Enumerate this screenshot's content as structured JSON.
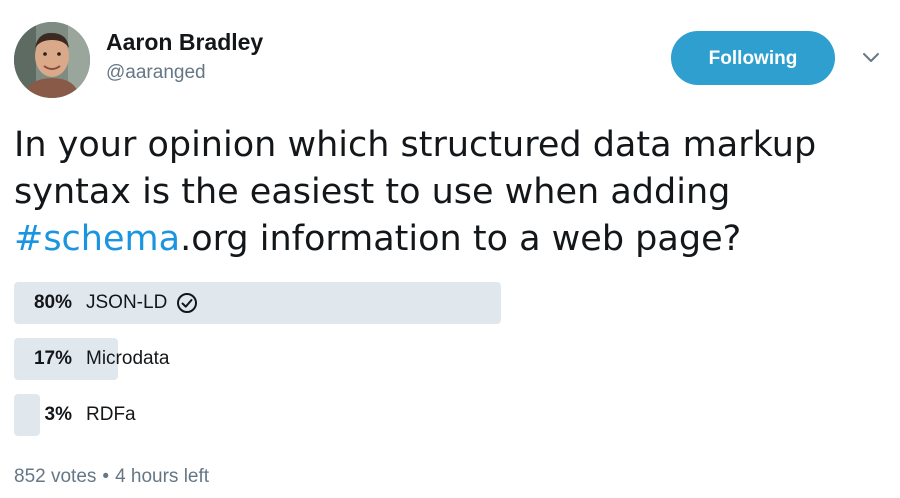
{
  "author": {
    "display_name": "Aaron Bradley",
    "handle": "@aaranged"
  },
  "follow_button": {
    "label": "Following",
    "color": "#2f9fcf"
  },
  "menu": {
    "icon": "chevron-down-icon"
  },
  "tweet": {
    "text_before": "In your opinion which structured data markup syntax is the easiest to use when adding ",
    "hashtag": "#schema",
    "text_after": ".org information to a web page?"
  },
  "poll": {
    "options": [
      {
        "percent": 80,
        "percent_label": "80%",
        "label": "JSON-LD",
        "winner": true
      },
      {
        "percent": 17,
        "percent_label": "17%",
        "label": "Microdata",
        "winner": false
      },
      {
        "percent": 3,
        "percent_label": "3%",
        "label": "RDFa",
        "winner": false
      }
    ],
    "votes": "852 votes",
    "separator": "•",
    "time_left": "4 hours left",
    "bar_color": "#e1e8ed"
  },
  "colors": {
    "hashtag": "#1b95e0",
    "muted": "#657786",
    "text": "#14171a"
  }
}
